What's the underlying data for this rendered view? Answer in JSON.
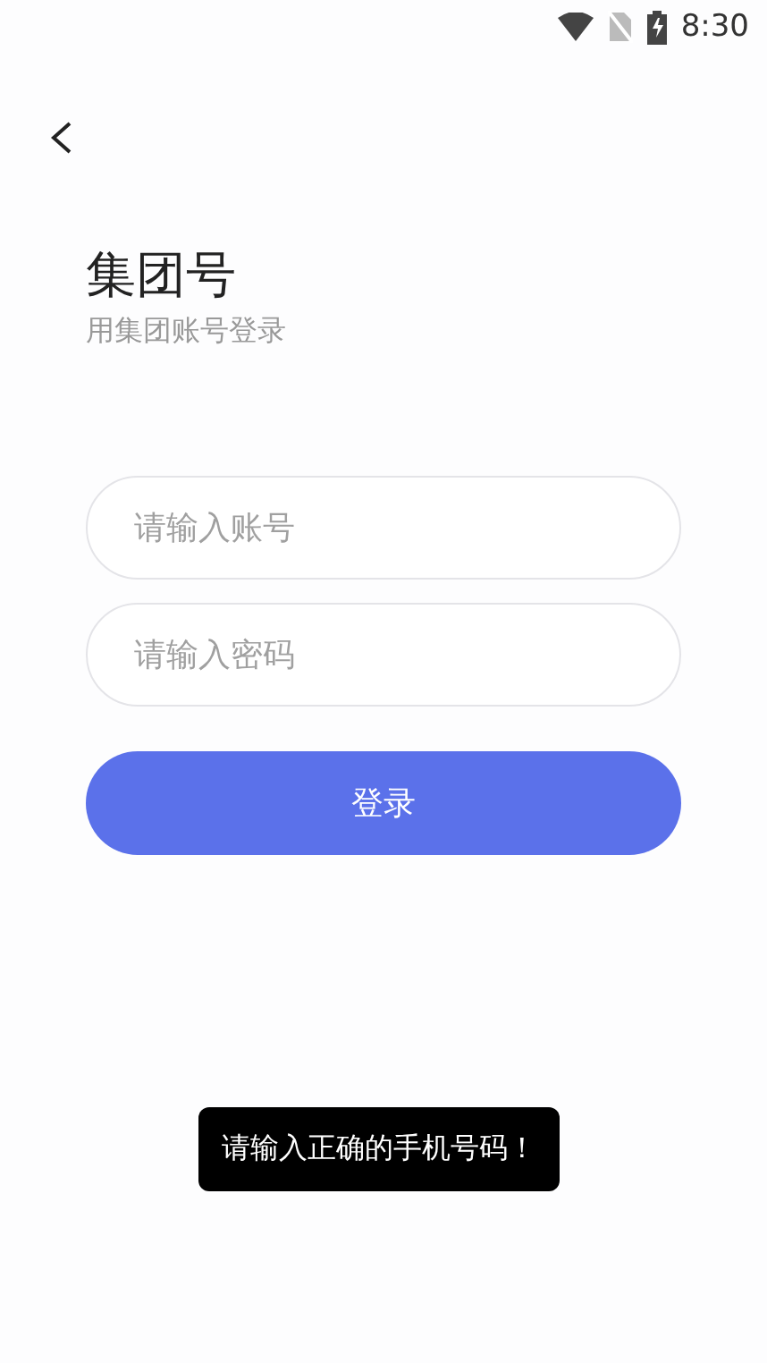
{
  "status_bar": {
    "time": "8:30"
  },
  "title": "集团号",
  "subtitle": "用集团账号登录",
  "fields": [
    {
      "placeholder": "请输入账号"
    },
    {
      "placeholder": "请输入密码"
    }
  ],
  "login_button": "登录",
  "toast": "请输入正确的手机号码！"
}
